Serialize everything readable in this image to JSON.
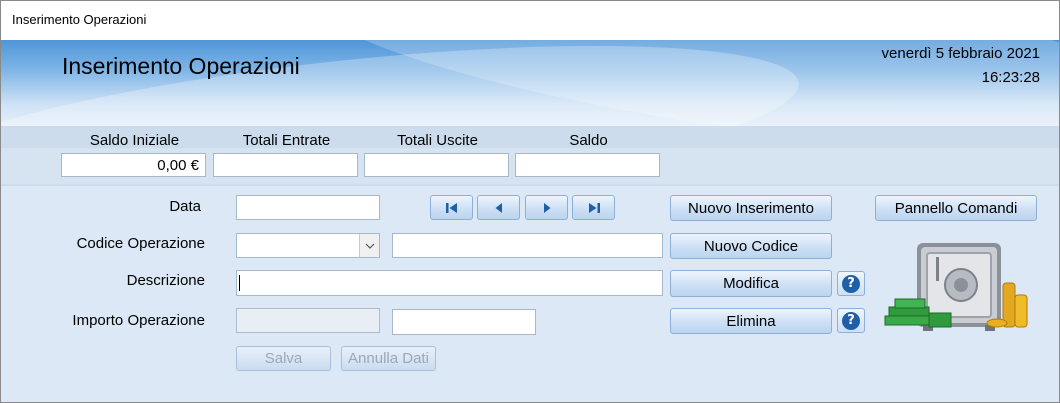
{
  "window": {
    "title": "Inserimento Operazioni"
  },
  "header": {
    "title": "Inserimento Operazioni",
    "date": "venerdì 5 febbraio 2021",
    "time": "16:23:28"
  },
  "totals": {
    "labels": [
      "Saldo Iniziale",
      "Totali Entrate",
      "Totali Uscite",
      "Saldo"
    ],
    "values": [
      "0,00 €",
      "",
      "",
      ""
    ]
  },
  "form": {
    "data_label": "Data",
    "codice_label": "Codice Operazione",
    "descrizione_label": "Descrizione",
    "importo_label": "Importo Operazione",
    "data_value": "",
    "codice_value": "",
    "codice_desc_value": "",
    "descrizione_value": "",
    "importo_value": "",
    "importo_extra_value": ""
  },
  "buttons": {
    "nuovo_inserimento": "Nuovo Inserimento",
    "pannello_comandi": "Pannello Comandi",
    "nuovo_codice": "Nuovo Codice",
    "modifica": "Modifica",
    "elimina": "Elimina",
    "salva": "Salva",
    "annulla_dati": "Annulla Dati"
  },
  "navigation": [
    "first-record-icon",
    "previous-record-icon",
    "next-record-icon",
    "last-record-icon"
  ],
  "icons": {
    "help": "?",
    "illustration": "safe-with-money-icon"
  },
  "colors": {
    "header_blue": "#4f95d8",
    "panel": "#dce8f6",
    "help_blue": "#1f5fa8"
  }
}
